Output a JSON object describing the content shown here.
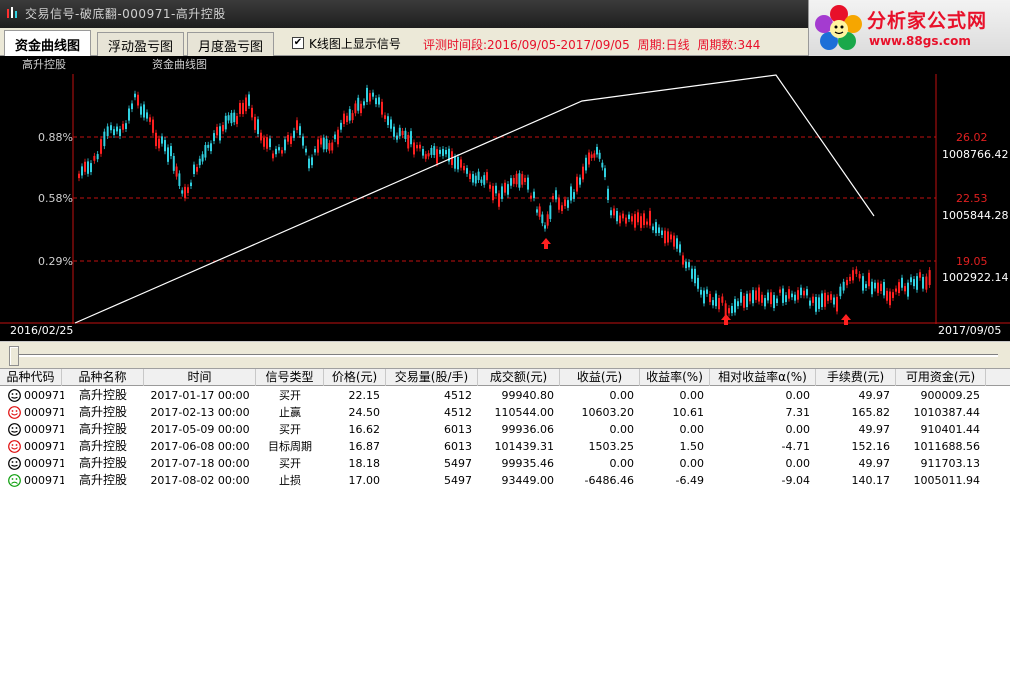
{
  "window": {
    "title": "交易信号-破底翻-000971-高升控股"
  },
  "logo": {
    "brand": "分析家公式网",
    "url": "www.88gs.com"
  },
  "tabs": [
    {
      "label": "资金曲线图",
      "active": true
    },
    {
      "label": "浮动盈亏图",
      "active": false
    },
    {
      "label": "月度盈亏图",
      "active": false
    }
  ],
  "options": {
    "show_signals_label": "K线图上显示信号",
    "show_signals_checked": true
  },
  "eval": {
    "period_label": "评测时间段:2016/09/05-2017/09/05",
    "cycle_label": "周期:日线",
    "count_label": "周期数:344"
  },
  "chart": {
    "stock_label": "高升控股",
    "curve_label": "资金曲线图",
    "left_ticks": [
      "0.88%",
      "0.58%",
      "0.29%"
    ],
    "right_price_ticks": [
      "26.02",
      "22.53",
      "19.05"
    ],
    "right_fund_ticks": [
      "1008766.42",
      "1005844.28",
      "1002922.14"
    ],
    "date_start": "2016/02/25",
    "date_end": "2017/09/05",
    "colors": {
      "up": "#ff2020",
      "down": "#30d0e0",
      "curve": "#ffffff",
      "grid": "#c01010",
      "signal": "#ff2020"
    }
  },
  "table": {
    "columns": [
      "品种代码",
      "品种名称",
      "时间",
      "信号类型",
      "价格(元)",
      "交易量(股/手)",
      "成交额(元)",
      "收益(元)",
      "收益率(%)",
      "相对收益率α(%)",
      "手续费(元)",
      "可用资金(元)"
    ],
    "rows": [
      {
        "face": "neutral",
        "code": "000971",
        "name": "高升控股",
        "time": "2017-01-17 00:00",
        "signal": "买开",
        "price": "22.15",
        "volume": "4512",
        "amount": "99940.80",
        "profit": "0.00",
        "rate": "0.00",
        "alpha": "0.00",
        "fee": "49.97",
        "fund": "900009.25"
      },
      {
        "face": "happy",
        "code": "000971",
        "name": "高升控股",
        "time": "2017-02-13 00:00",
        "signal": "止赢",
        "price": "24.50",
        "volume": "4512",
        "amount": "110544.00",
        "profit": "10603.20",
        "rate": "10.61",
        "alpha": "7.31",
        "fee": "165.82",
        "fund": "1010387.44"
      },
      {
        "face": "neutral",
        "code": "000971",
        "name": "高升控股",
        "time": "2017-05-09 00:00",
        "signal": "买开",
        "price": "16.62",
        "volume": "6013",
        "amount": "99936.06",
        "profit": "0.00",
        "rate": "0.00",
        "alpha": "0.00",
        "fee": "49.97",
        "fund": "910401.44"
      },
      {
        "face": "happy",
        "code": "000971",
        "name": "高升控股",
        "time": "2017-06-08 00:00",
        "signal": "目标周期",
        "price": "16.87",
        "volume": "6013",
        "amount": "101439.31",
        "profit": "1503.25",
        "rate": "1.50",
        "alpha": "-4.71",
        "fee": "152.16",
        "fund": "1011688.56"
      },
      {
        "face": "neutral",
        "code": "000971",
        "name": "高升控股",
        "time": "2017-07-18 00:00",
        "signal": "买开",
        "price": "18.18",
        "volume": "5497",
        "amount": "99935.46",
        "profit": "0.00",
        "rate": "0.00",
        "alpha": "0.00",
        "fee": "49.97",
        "fund": "911703.13"
      },
      {
        "face": "sad",
        "code": "000971",
        "name": "高升控股",
        "time": "2017-08-02 00:00",
        "signal": "止损",
        "price": "17.00",
        "volume": "5497",
        "amount": "93449.00",
        "profit": "-6486.46",
        "rate": "-6.49",
        "alpha": "-9.04",
        "fee": "140.17",
        "fund": "1005011.94"
      }
    ]
  }
}
